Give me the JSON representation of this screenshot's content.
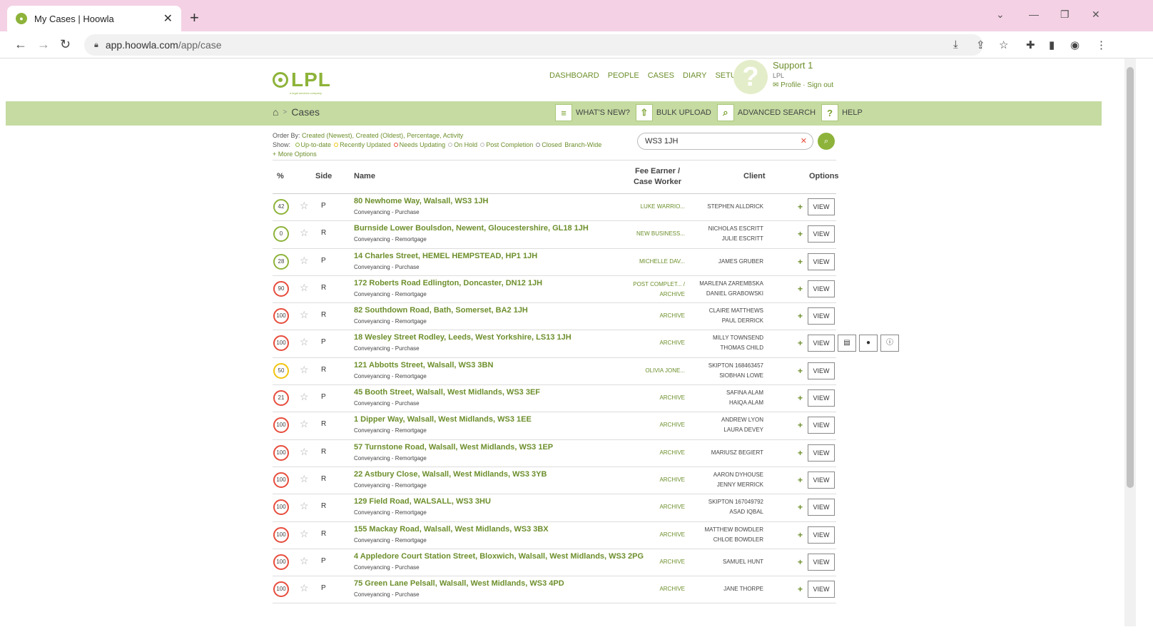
{
  "browser": {
    "tab_title": "My Cases | Hoowla",
    "new_tab": "+",
    "url_host": "app.hoowla.com",
    "url_path": "/app/case"
  },
  "app": {
    "logo_text": "LPL",
    "logo_tag": "a legal services company",
    "nav": [
      "DASHBOARD",
      "PEOPLE",
      "CASES",
      "DIARY",
      "SETUP"
    ],
    "avatar_glyph": "?",
    "user_name": "Support 1",
    "user_org": "LPL",
    "user_links": "Profile · Sign out"
  },
  "bar": {
    "crumb": "Cases",
    "actions": [
      "WHAT'S NEW?",
      "BULK UPLOAD",
      "ADVANCED SEARCH",
      "HELP"
    ]
  },
  "filters": {
    "order_label": "Order By:",
    "order_items": [
      "Created (Newest),",
      "Created (Oldest),",
      "Percentage,",
      "Activity"
    ],
    "show_label": "Show:",
    "show_items": [
      {
        "label": "Up-to-date",
        "color": "#8db33a"
      },
      {
        "label": "Recently Updated",
        "color": "#f1c40f"
      },
      {
        "label": "Needs Updating",
        "color": "#e74c3c"
      },
      {
        "label": "On Hold",
        "color": "#bbbbbb"
      },
      {
        "label": "Post Completion",
        "color": "#bbbbbb"
      },
      {
        "label": "Closed",
        "color": "#888888"
      }
    ],
    "branch": "Branch-Wide",
    "more": "More Options"
  },
  "search": {
    "value": "WS3 1JH"
  },
  "table": {
    "headers": {
      "pct": "%",
      "side": "Side",
      "name": "Name",
      "fee": "Fee Earner /\nCase Worker",
      "client": "Client",
      "options": "Options"
    },
    "view_label": "VIEW",
    "rows": [
      {
        "pct": "42",
        "ring": "#8db33a",
        "side": "P",
        "name": "80 Newhome Way, Walsall, WS3 1JH",
        "type": "Conveyancing - Purchase",
        "fee": [
          "LUKE WARRIO..."
        ],
        "client": [
          "STEPHEN ALLDRICK"
        ]
      },
      {
        "pct": "0",
        "ring": "#8db33a",
        "side": "R",
        "name": "Burnside Lower Boulsdon, Newent, Gloucestershire, GL18 1JH",
        "type": "Conveyancing - Remortgage",
        "fee": [
          "NEW BUSINESS..."
        ],
        "client": [
          "NICHOLAS ESCRITT",
          "JULIE ESCRITT"
        ]
      },
      {
        "pct": "28",
        "ring": "#8db33a",
        "side": "P",
        "name": "14 Charles Street, HEMEL HEMPSTEAD, HP1 1JH",
        "type": "Conveyancing - Purchase",
        "fee": [
          "MICHELLE DAV..."
        ],
        "client": [
          "JAMES GRUBER"
        ]
      },
      {
        "pct": "90",
        "ring": "#e74c3c",
        "side": "R",
        "name": "172 Roberts Road Edlington, Doncaster, DN12 1JH",
        "type": "Conveyancing - Remortgage",
        "fee": [
          "POST COMPLET... /",
          "ARCHIVE"
        ],
        "client": [
          "MARLENA ZAREMBSKA",
          "DANIEL GRABOWSKI"
        ]
      },
      {
        "pct": "100",
        "ring": "#e74c3c",
        "side": "R",
        "name": "82 Southdown Road, Bath, Somerset, BA2 1JH",
        "type": "Conveyancing - Remortgage",
        "fee": [
          "ARCHIVE"
        ],
        "client": [
          "CLAIRE MATTHEWS",
          "PAUL DERRICK"
        ]
      },
      {
        "pct": "100",
        "ring": "#e74c3c",
        "side": "P",
        "name": "18 Wesley Street Rodley, Leeds, West Yorkshire, LS13 1JH",
        "type": "Conveyancing - Purchase",
        "fee": [
          "ARCHIVE"
        ],
        "client": [
          "MILLY TOWNSEND",
          "THOMAS CHILD"
        ],
        "extras": [
          "doc-icon",
          "comment-icon",
          "info-icon"
        ]
      },
      {
        "pct": "50",
        "ring": "#f1c40f",
        "side": "R",
        "name": "121 Abbotts Street, Walsall, WS3 3BN",
        "type": "Conveyancing - Remortgage",
        "fee": [
          "OLIVIA JONE..."
        ],
        "client": [
          "SKIPTON 168463457",
          "SIOBHAN LOWE"
        ]
      },
      {
        "pct": "21",
        "ring": "#e74c3c",
        "side": "P",
        "name": "45 Booth Street, Walsall, West Midlands, WS3 3EF",
        "type": "Conveyancing - Purchase",
        "fee": [
          "ARCHIVE"
        ],
        "client": [
          "SAFINA ALAM",
          "HAIQA ALAM"
        ]
      },
      {
        "pct": "100",
        "ring": "#e74c3c",
        "side": "R",
        "name": "1 Dipper Way, Walsall, West Midlands, WS3 1EE",
        "type": "Conveyancing - Remortgage",
        "fee": [
          "ARCHIVE"
        ],
        "client": [
          "ANDREW LYON",
          "LAURA DEVEY"
        ]
      },
      {
        "pct": "100",
        "ring": "#e74c3c",
        "side": "R",
        "name": "57 Turnstone Road, Walsall, West Midlands, WS3 1EP",
        "type": "Conveyancing - Remortgage",
        "fee": [
          "ARCHIVE"
        ],
        "client": [
          "MARIUSZ BEGIERT"
        ]
      },
      {
        "pct": "100",
        "ring": "#e74c3c",
        "side": "R",
        "name": "22 Astbury Close, Walsall, West Midlands, WS3 3YB",
        "type": "Conveyancing - Remortgage",
        "fee": [
          "ARCHIVE"
        ],
        "client": [
          "AARON DYHOUSE",
          "JENNY MERRICK"
        ]
      },
      {
        "pct": "100",
        "ring": "#e74c3c",
        "side": "R",
        "name": "129 Field Road, WALSALL, WS3 3HU",
        "type": "Conveyancing - Remortgage",
        "fee": [
          "ARCHIVE"
        ],
        "client": [
          "SKIPTON 167049792",
          "ASAD IQBAL"
        ]
      },
      {
        "pct": "100",
        "ring": "#e74c3c",
        "side": "R",
        "name": "155 Mackay Road, Walsall, West Midlands, WS3 3BX",
        "type": "Conveyancing - Remortgage",
        "fee": [
          "ARCHIVE"
        ],
        "client": [
          "MATTHEW BOWDLER",
          "CHLOE BOWDLER"
        ]
      },
      {
        "pct": "100",
        "ring": "#e74c3c",
        "side": "P",
        "name": "4 Appledore Court Station Street, Bloxwich, Walsall, West Midlands, WS3 2PG",
        "type": "Conveyancing - Purchase",
        "fee": [
          "ARCHIVE"
        ],
        "client": [
          "SAMUEL HUNT"
        ]
      },
      {
        "pct": "100",
        "ring": "#e74c3c",
        "side": "P",
        "name": "75 Green Lane Pelsall, Walsall, West Midlands, WS3 4PD",
        "type": "Conveyancing - Purchase",
        "fee": [
          "ARCHIVE"
        ],
        "client": [
          "JANE THORPE"
        ]
      }
    ]
  }
}
